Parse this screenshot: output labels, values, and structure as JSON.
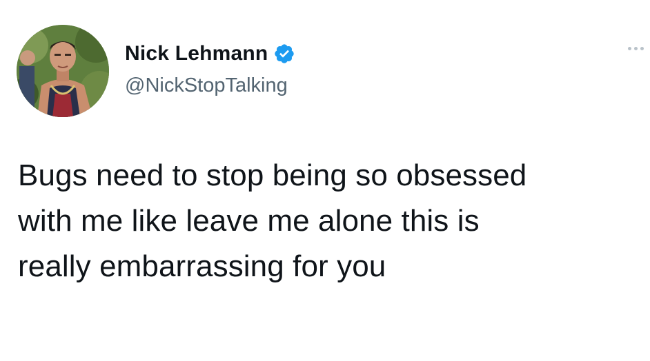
{
  "tweet": {
    "author": {
      "display_name": "Nick Lehmann",
      "handle": "@NickStopTalking",
      "verified": true,
      "avatar_icon": "profile-photo"
    },
    "text_lines": [
      "Bugs need to stop being so obsessed",
      "with me like leave me alone this is",
      "really embarrassing for you"
    ],
    "colors": {
      "name": "#0f1419",
      "handle": "#536471",
      "verified_badge": "#1d9bf0",
      "background": "#ffffff"
    },
    "icons": {
      "verified": "verified-badge-icon",
      "more": "more-options-icon"
    }
  }
}
